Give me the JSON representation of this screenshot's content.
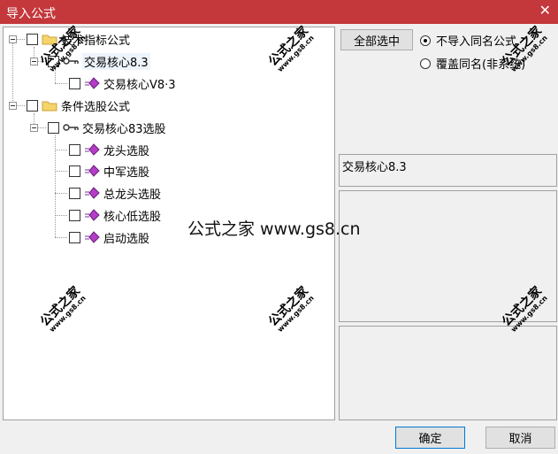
{
  "window": {
    "title": "导入公式"
  },
  "tree": {
    "nodes": [
      {
        "label": "技术指标公式"
      },
      {
        "label": "交易核心8.3"
      },
      {
        "label": "交易核心V8·3"
      },
      {
        "label": "条件选股公式"
      },
      {
        "label": "交易核心83选股"
      },
      {
        "label": "龙头选股"
      },
      {
        "label": "中军选股"
      },
      {
        "label": "总龙头选股"
      },
      {
        "label": "核心低选股"
      },
      {
        "label": "启动选股"
      }
    ]
  },
  "options": {
    "select_all": "全部选中",
    "radio_skip": "不导入同名公式",
    "radio_overwrite": "覆盖同名(非系统)"
  },
  "details": {
    "name": "交易核心8.3"
  },
  "buttons": {
    "ok": "确定",
    "cancel": "取消"
  },
  "watermark": {
    "text": "公式之家",
    "url": "www.gs8.cn",
    "center": "公式之家 www.gs8.cn"
  },
  "colors": {
    "titlebar": "#c4373b",
    "accent": "#0078d7"
  }
}
